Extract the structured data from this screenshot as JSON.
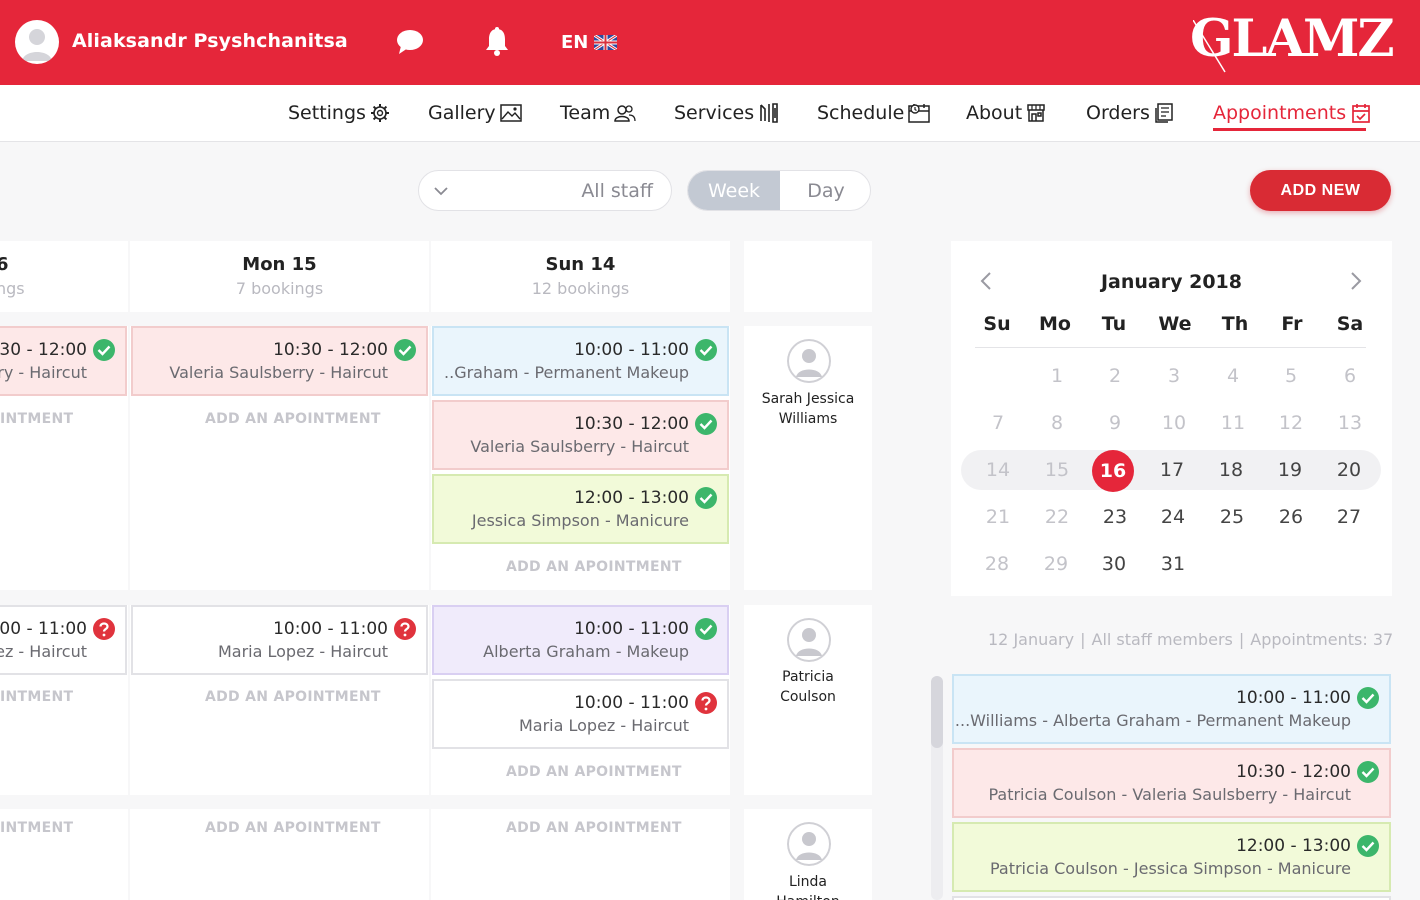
{
  "header": {
    "username": "Aliaksandr Psyshchanitsa",
    "language": "EN",
    "logo": "GLAMZ",
    "icons": [
      "user-avatar",
      "chat-bubble-icon",
      "bell-icon",
      "uk-flag-icon"
    ]
  },
  "nav": [
    {
      "label": "Settings",
      "icon": "gear-icon"
    },
    {
      "label": "Gallery",
      "icon": "image-icon"
    },
    {
      "label": "Team",
      "icon": "team-icon"
    },
    {
      "label": "Services",
      "icon": "services-icon"
    },
    {
      "label": "Schedule",
      "icon": "schedule-icon"
    },
    {
      "label": "About",
      "icon": "shop-icon"
    },
    {
      "label": "Orders",
      "icon": "orders-icon"
    },
    {
      "label": "Appointments",
      "icon": "calendar-check-icon",
      "active": true
    }
  ],
  "controls": {
    "staff_filter": "All staff",
    "view_week": "Week",
    "view_day": "Day",
    "active_view": "Week",
    "add_new": "ADD NEW"
  },
  "columns": [
    {
      "title": "6",
      "subtitle": "ngs"
    },
    {
      "title": "Mon 15",
      "subtitle": "7 bookings"
    },
    {
      "title": "Sun 14",
      "subtitle": "12 bookings"
    }
  ],
  "appointments": {
    "c0_1": {
      "time": "0:30 - 12:00",
      "desc": "ry - Haircut",
      "status": "confirmed"
    },
    "c0_2": {
      "time": "0:00 - 11:00",
      "desc": "ez - Haircut",
      "status": "unconfirmed"
    },
    "c1_1": {
      "time": "10:30 - 12:00",
      "desc": "Valeria Saulsberry - Haircut",
      "status": "confirmed"
    },
    "c1_2": {
      "time": "10:00 - 11:00",
      "desc": "Maria Lopez - Haircut",
      "status": "unconfirmed"
    },
    "c2_1": {
      "time": "10:00 - 11:00",
      "desc": "..Graham - Permanent Makeup",
      "status": "confirmed"
    },
    "c2_2": {
      "time": "10:30 - 12:00",
      "desc": "Valeria Saulsberry - Haircut",
      "status": "confirmed"
    },
    "c2_3": {
      "time": "12:00 - 13:00",
      "desc": "Jessica Simpson - Manicure",
      "status": "confirmed"
    },
    "c2_4": {
      "time": "10:00 - 11:00",
      "desc": "Alberta Graham - Makeup",
      "status": "confirmed"
    },
    "c2_5": {
      "time": "10:00 - 11:00",
      "desc": "Maria Lopez - Haircut",
      "status": "unconfirmed"
    }
  },
  "add_appointment_label": "ADD AN APOINTMENT",
  "add_appointment_clipped": "INTMENT",
  "staff": [
    {
      "name_line1": "Sarah Jessica",
      "name_line2": "Williams"
    },
    {
      "name_line1": "Patricia",
      "name_line2": "Coulson"
    },
    {
      "name_line1": "Linda",
      "name_line2": "Hamilton"
    }
  ],
  "calendar": {
    "month_label": "January 2018",
    "weekdays": [
      "Su",
      "Mo",
      "Tu",
      "We",
      "Th",
      "Fr",
      "Sa"
    ],
    "weeks": [
      [
        "",
        "1",
        "2",
        "3",
        "4",
        "5",
        "6"
      ],
      [
        "7",
        "8",
        "9",
        "10",
        "11",
        "12",
        "13"
      ],
      [
        "14",
        "15",
        "16",
        "17",
        "18",
        "19",
        "20"
      ],
      [
        "21",
        "22",
        "23",
        "24",
        "25",
        "26",
        "27"
      ],
      [
        "28",
        "29",
        "30",
        "31",
        "",
        "",
        ""
      ]
    ],
    "selected_day": "16",
    "today_indicator_color": "#e5263a"
  },
  "summary": {
    "date": "12 January",
    "staff": "All staff members",
    "appointments": "Appointments: 37"
  },
  "day_list": [
    {
      "time": "10:00 - 11:00",
      "desc": "...Williams - Alberta Graham - Permanent Makeup",
      "status": "confirmed"
    },
    {
      "time": "10:30 - 12:00",
      "desc": "Patricia Coulson - Valeria Saulsberry - Haircut",
      "status": "confirmed"
    },
    {
      "time": "12:00 - 13:00",
      "desc": "Patricia Coulson - Jessica Simpson - Manicure",
      "status": "confirmed"
    }
  ],
  "colors": {
    "brand_red": "#e5263a",
    "confirmed_green": "#3cb66b",
    "unconfirmed_red": "#e0333d",
    "pink_card": "#fde8e8",
    "blue_card": "#eaf5fc",
    "green_card": "#f2fad9",
    "purple_card": "#f0ebfb"
  }
}
